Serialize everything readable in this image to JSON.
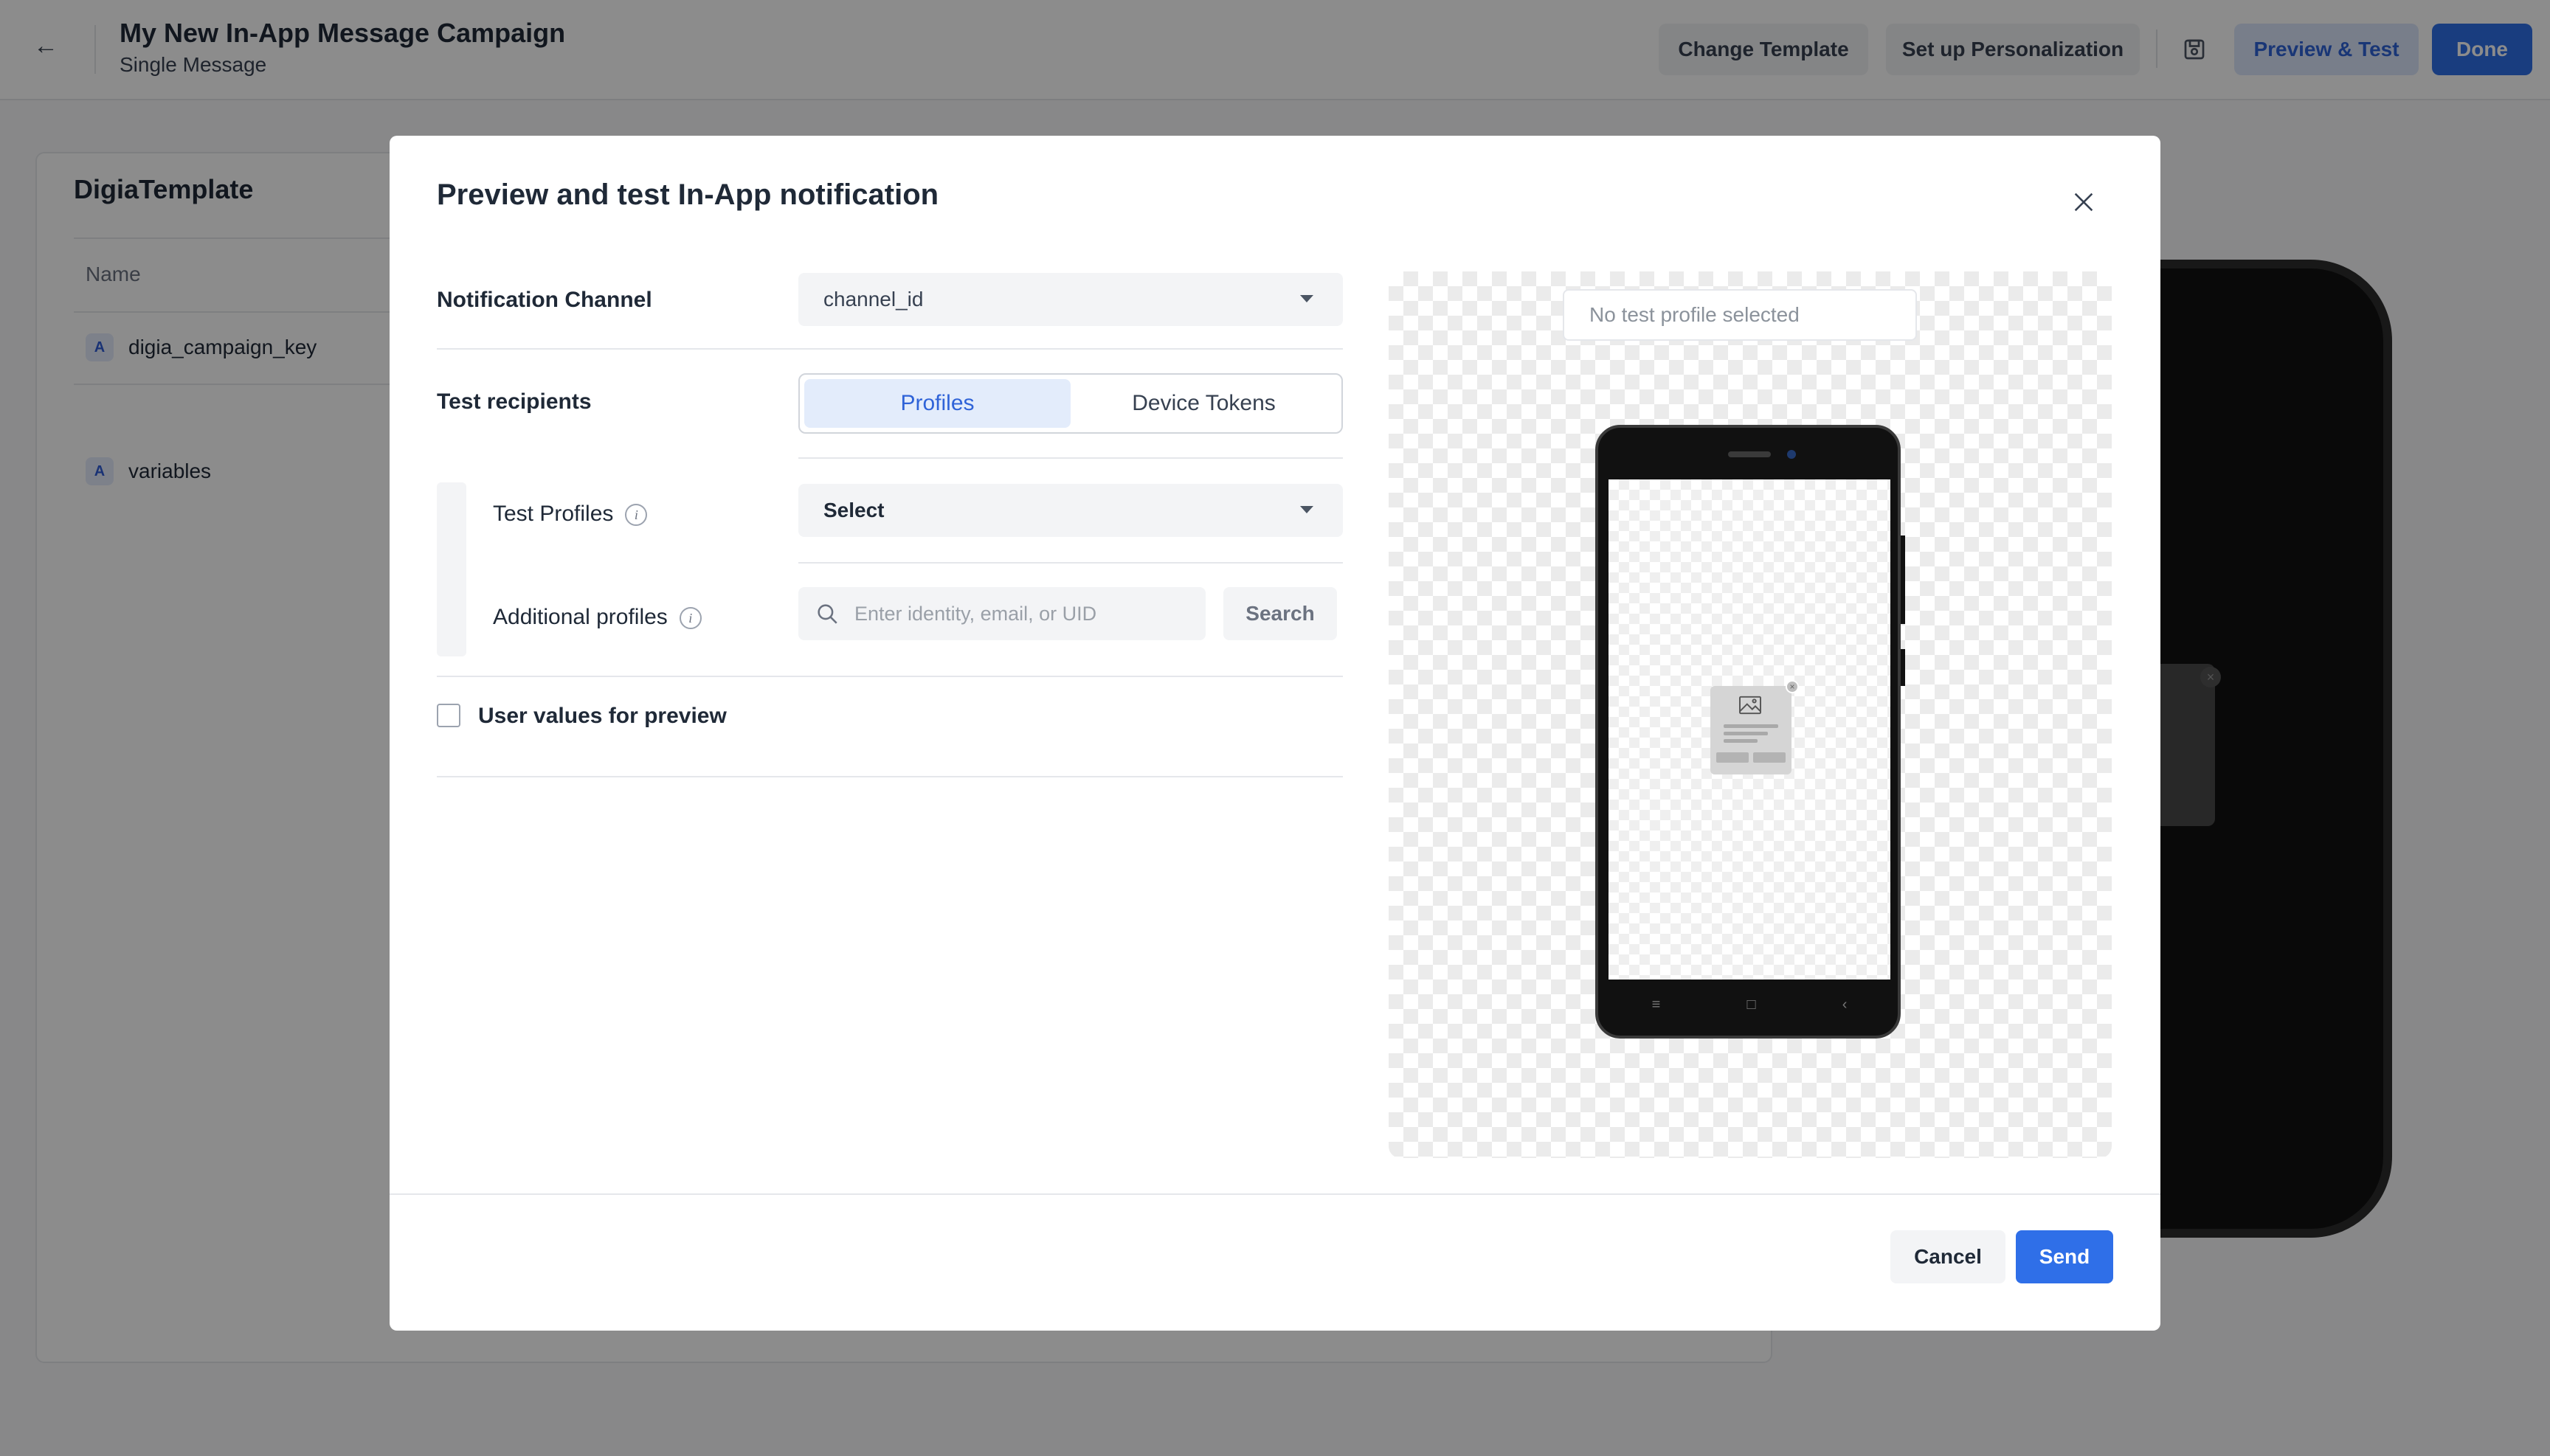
{
  "header": {
    "title": "My New In-App Message Campaign",
    "subtitle": "Single Message",
    "change_template": "Change Template",
    "personalization": "Set up Personalization",
    "preview_test": "Preview & Test",
    "done": "Done"
  },
  "template_panel": {
    "title": "DigiaTemplate",
    "column_name": "Name",
    "fields": [
      {
        "type": "A",
        "name": "digia_campaign_key"
      },
      {
        "type": "A",
        "name": "variables"
      }
    ]
  },
  "modal": {
    "title": "Preview and test In-App notification",
    "channel_label": "Notification Channel",
    "channel_value": "channel_id",
    "recipients_label": "Test recipients",
    "tabs": [
      {
        "label": "Profiles",
        "active": true
      },
      {
        "label": "Device Tokens",
        "active": false
      }
    ],
    "test_profiles_label": "Test Profiles",
    "test_profiles_value": "Select",
    "additional_profiles_label": "Additional profiles",
    "search_placeholder": "Enter identity, email, or UID",
    "search_button": "Search",
    "user_values_label": "User values for preview",
    "user_values_checked": false,
    "preview_profile_text": "No test profile selected",
    "cancel": "Cancel",
    "send": "Send"
  },
  "colors": {
    "primary": "#2f6fe8",
    "active_tab_bg": "#e3ecfb"
  }
}
